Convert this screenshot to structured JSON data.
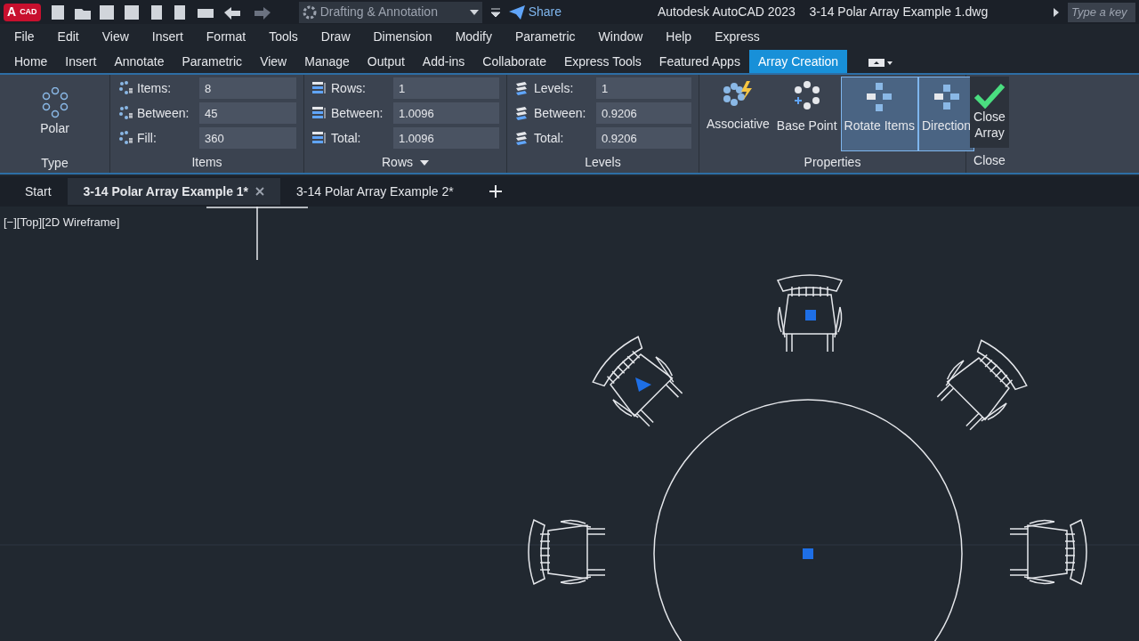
{
  "title_bar": {
    "app_letter": "A",
    "app_badge": "CAD",
    "workspace": "Drafting & Annotation",
    "share": "Share",
    "title": "Autodesk AutoCAD 2023    3-14 Polar Array Example 1.dwg",
    "search": {
      "placeholder": "Type a key"
    }
  },
  "menu_bar": [
    "File",
    "Edit",
    "View",
    "Insert",
    "Format",
    "Tools",
    "Draw",
    "Dimension",
    "Modify",
    "Parametric",
    "Window",
    "Help",
    "Express"
  ],
  "ribbon_tabs": [
    {
      "label": "Home",
      "selected": false
    },
    {
      "label": "Insert",
      "selected": false
    },
    {
      "label": "Annotate",
      "selected": false
    },
    {
      "label": "Parametric",
      "selected": false
    },
    {
      "label": "View",
      "selected": false
    },
    {
      "label": "Manage",
      "selected": false
    },
    {
      "label": "Output",
      "selected": false
    },
    {
      "label": "Add-ins",
      "selected": false
    },
    {
      "label": "Collaborate",
      "selected": false
    },
    {
      "label": "Express Tools",
      "selected": false
    },
    {
      "label": "Featured Apps",
      "selected": false
    },
    {
      "label": "Array Creation",
      "selected": true
    }
  ],
  "ribbon": {
    "type_panel": {
      "button": "Polar",
      "title": "Type"
    },
    "field_panels": [
      {
        "title": "Items",
        "dropdown": false,
        "fields": [
          {
            "label": "Items:",
            "value": "8"
          },
          {
            "label": "Between:",
            "value": "45"
          },
          {
            "label": "Fill:",
            "value": "360"
          }
        ]
      },
      {
        "title": "Rows",
        "dropdown": true,
        "fields": [
          {
            "label": "Rows:",
            "value": "1"
          },
          {
            "label": "Between:",
            "value": "1.0096"
          },
          {
            "label": "Total:",
            "value": "1.0096"
          }
        ]
      },
      {
        "title": "Levels",
        "dropdown": false,
        "fields": [
          {
            "label": "Levels:",
            "value": "1"
          },
          {
            "label": "Between:",
            "value": "0.9206"
          },
          {
            "label": "Total:",
            "value": "0.9206"
          }
        ]
      }
    ],
    "properties": {
      "title": "Properties",
      "buttons": [
        {
          "label": "Associative",
          "kind": "associative",
          "selected": false
        },
        {
          "label": "Base Point",
          "kind": "basepoint",
          "selected": false
        },
        {
          "label": "Rotate Items",
          "kind": "rotate",
          "selected": true
        },
        {
          "label": "Direction",
          "kind": "direction",
          "selected": true
        }
      ]
    },
    "close": {
      "button": "Close Array",
      "title": "Close"
    }
  },
  "file_tabs": [
    {
      "label": "Start",
      "selected": false,
      "closable": false
    },
    {
      "label": "3-14 Polar Array Example 1*",
      "selected": true,
      "closable": true
    },
    {
      "label": "3-14 Polar Array Example 2*",
      "selected": false,
      "closable": false
    }
  ],
  "viewport": {
    "label": "[−][Top][2D Wireframe]"
  }
}
